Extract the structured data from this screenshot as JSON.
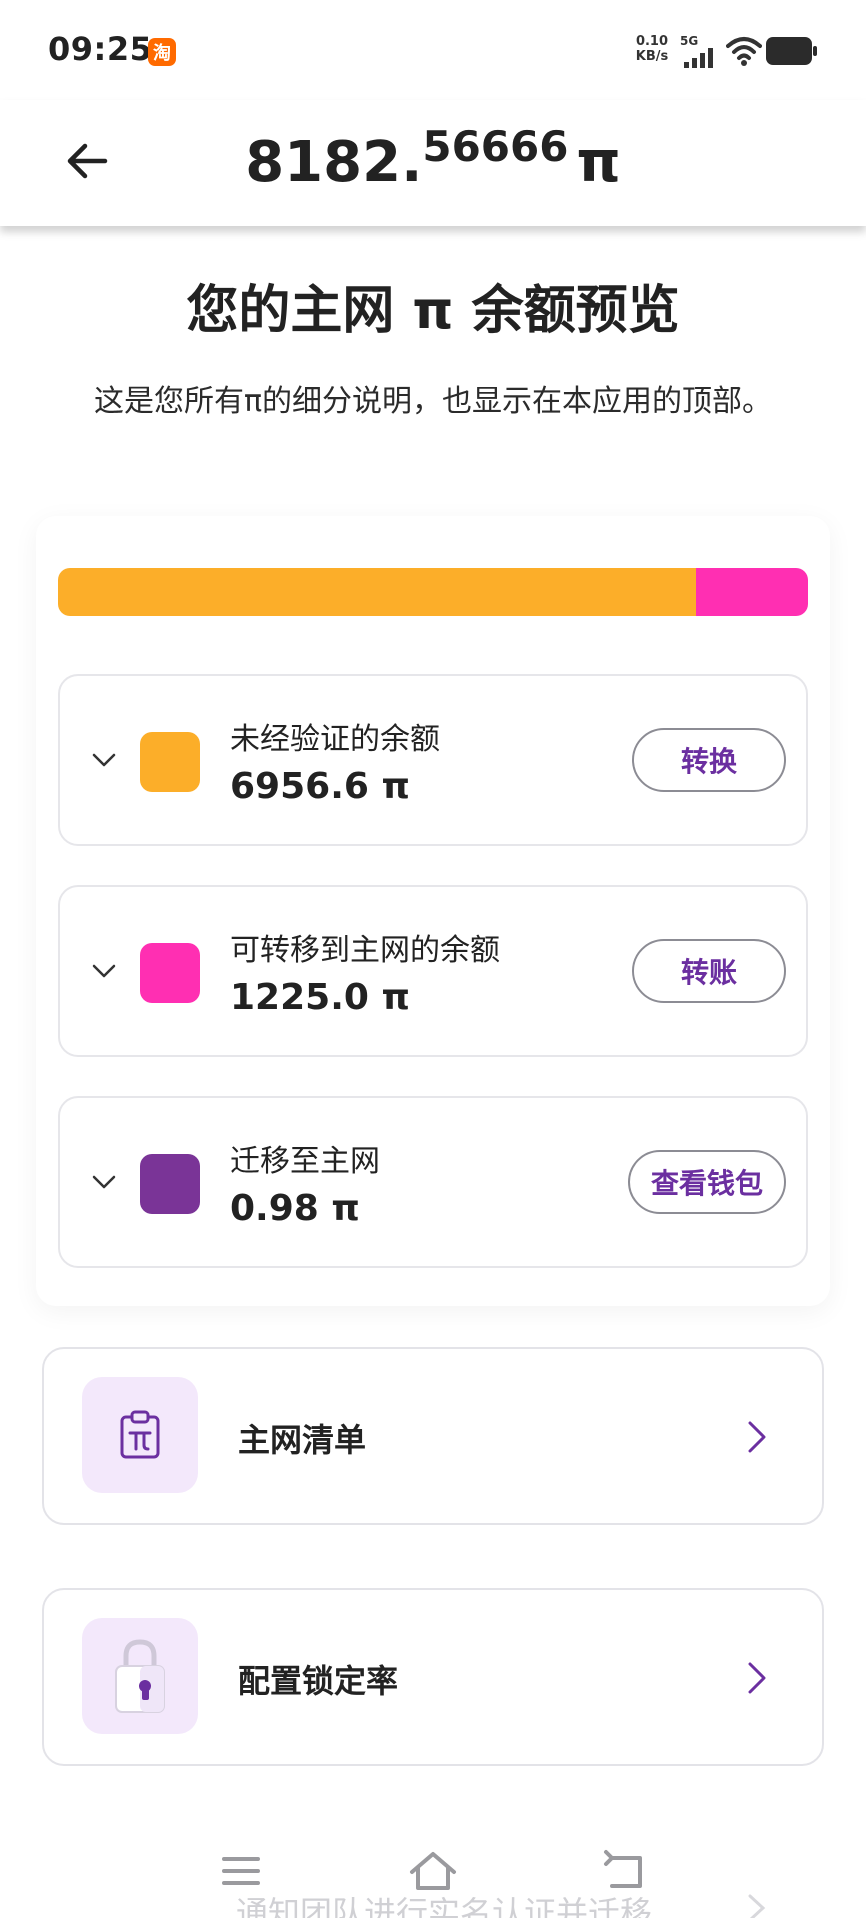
{
  "status_bar": {
    "time": "09:25",
    "app_badge": "淘",
    "net_speed_value": "0.10",
    "net_speed_unit": "KB/s",
    "network_type": "5G"
  },
  "header": {
    "balance_integer": "8182.",
    "balance_decimal": "56666",
    "balance_unit": "π"
  },
  "page": {
    "title": "您的主网 π 余额预览",
    "description": "这是您所有π的细分说明，也显示在本应用的顶部。"
  },
  "progress": {
    "segments": [
      {
        "name": "未经验证的余额",
        "value": 6956.6,
        "color": "#fcae29"
      },
      {
        "name": "可转移到主网的余额",
        "value": 1225.0,
        "color": "#ff2fb2"
      },
      {
        "name": "迁移至主网",
        "value": 0.98,
        "color": "#7a3497"
      }
    ]
  },
  "balances": [
    {
      "label": "未经验证的余额",
      "value": "6956.6 π",
      "color": "#fcae29",
      "button": "转换"
    },
    {
      "label": "可转移到主网的余额",
      "value": "1225.0 π",
      "color": "#ff2fb2",
      "button": "转账"
    },
    {
      "label": "迁移至主网",
      "value": "0.98 π",
      "color": "#7a3497",
      "button": "查看钱包"
    }
  ],
  "links": [
    {
      "label": "主网清单",
      "icon": "clipboard-pi-icon"
    },
    {
      "label": "配置锁定率",
      "icon": "padlock-icon"
    }
  ],
  "partial_notice": "通知团队进行实名认证并迁移",
  "colors": {
    "accent_purple": "#6b2fa0",
    "icon_bg": "#f3e8fb"
  }
}
